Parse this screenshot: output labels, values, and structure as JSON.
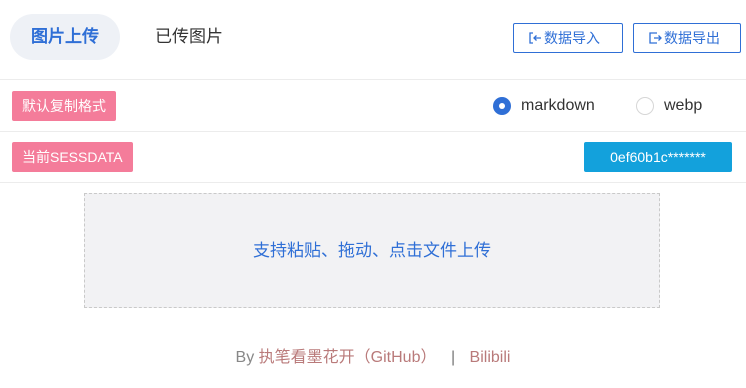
{
  "header": {
    "tabs": [
      {
        "label": "图片上传",
        "active": true
      },
      {
        "label": "已传图片",
        "active": false
      }
    ],
    "import_label": "数据导入",
    "export_label": "数据导出"
  },
  "format": {
    "tag_label": "默认复制格式",
    "options": [
      {
        "label": "markdown",
        "selected": true
      },
      {
        "label": "webp",
        "selected": false
      }
    ]
  },
  "session": {
    "tag_label": "当前SESSDATA",
    "value": "0ef60b1c*******"
  },
  "dropzone": {
    "text": "支持粘贴、拖动、点击文件上传"
  },
  "footer": {
    "by": "By",
    "author": "执笔看墨花开（GitHub）",
    "separator": "|",
    "site": "Bilibili"
  },
  "colors": {
    "accent": "#2f6fd6",
    "tag_pink": "#f47c9a",
    "sess_blue": "#13a1dc",
    "footer_link": "#b97a7a"
  }
}
